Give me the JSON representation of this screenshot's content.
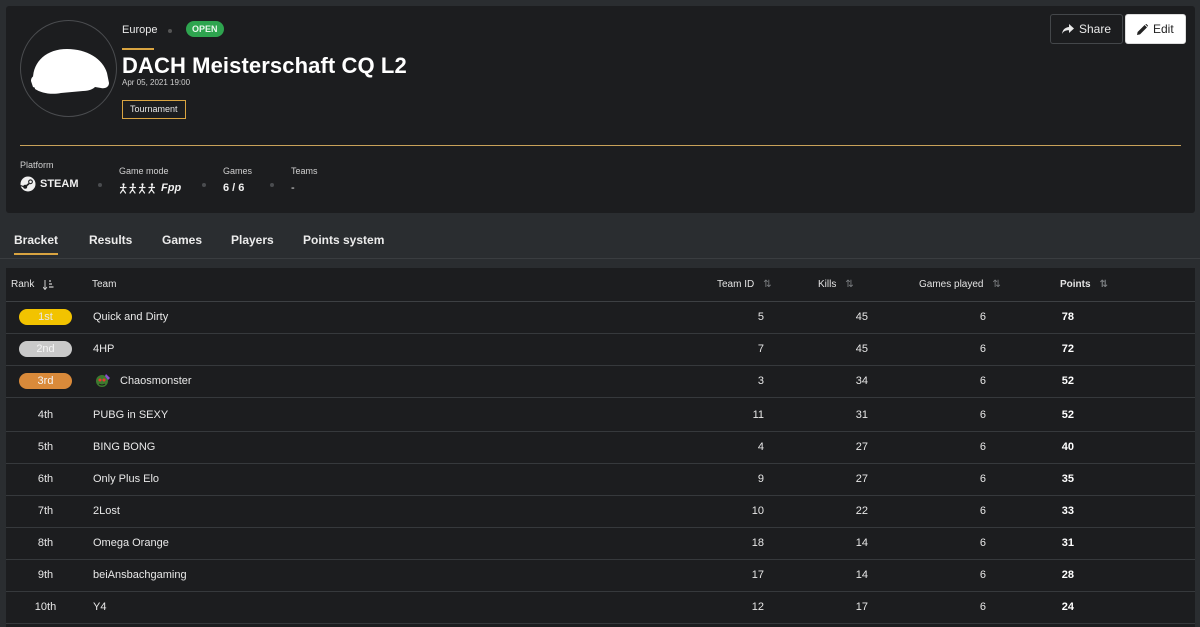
{
  "header": {
    "region": "Europe",
    "status_badge": "OPEN",
    "title": "DACH Meisterschaft CQ L2",
    "date": "Apr 05, 2021 19:00",
    "type_tag": "Tournament",
    "share_label": "Share",
    "edit_label": "Edit"
  },
  "stats": {
    "platform_label": "Platform",
    "platform_value": "STEAM",
    "gamemode_label": "Game mode",
    "gamemode_value": "Fpp",
    "games_label": "Games",
    "games_value": "6 / 6",
    "teams_label": "Teams",
    "teams_value": "-"
  },
  "tabs": [
    "Bracket",
    "Results",
    "Games",
    "Players",
    "Points system"
  ],
  "table": {
    "headers": {
      "rank": "Rank",
      "team": "Team",
      "team_id": "Team ID",
      "kills": "Kills",
      "games_played": "Games played",
      "points": "Points"
    },
    "rows": [
      {
        "rank": "1st",
        "team": "Quick and Dirty",
        "team_id": "5",
        "kills": "45",
        "games": "6",
        "points": "78",
        "medal": "gold"
      },
      {
        "rank": "2nd",
        "team": "4HP",
        "team_id": "7",
        "kills": "45",
        "games": "6",
        "points": "72",
        "medal": "silver"
      },
      {
        "rank": "3rd",
        "team": "Chaosmonster",
        "team_id": "3",
        "kills": "34",
        "games": "6",
        "points": "52",
        "medal": "bronze",
        "avatar": true
      },
      {
        "rank": "4th",
        "team": "PUBG in SEXY",
        "team_id": "11",
        "kills": "31",
        "games": "6",
        "points": "52"
      },
      {
        "rank": "5th",
        "team": "BING BONG",
        "team_id": "4",
        "kills": "27",
        "games": "6",
        "points": "40"
      },
      {
        "rank": "6th",
        "team": "Only Plus Elo",
        "team_id": "9",
        "kills": "27",
        "games": "6",
        "points": "35"
      },
      {
        "rank": "7th",
        "team": "2Lost",
        "team_id": "10",
        "kills": "22",
        "games": "6",
        "points": "33"
      },
      {
        "rank": "8th",
        "team": "Omega Orange",
        "team_id": "18",
        "kills": "14",
        "games": "6",
        "points": "31"
      },
      {
        "rank": "9th",
        "team": "beiAnsbachgaming",
        "team_id": "17",
        "kills": "14",
        "games": "6",
        "points": "28"
      },
      {
        "rank": "10th",
        "team": "Y4",
        "team_id": "12",
        "kills": "17",
        "games": "6",
        "points": "24"
      }
    ]
  },
  "colors": {
    "accent": "#d9a441",
    "open_badge": "#2ea44f",
    "gold": "#f2c300",
    "silver": "#c9c9c9",
    "bronze": "#d98a3a"
  },
  "icons": {
    "share": "share-icon",
    "edit": "pencil-icon",
    "platform": "steam-icon",
    "gamemode": "runners-icon",
    "logo": "helmet-icon"
  }
}
